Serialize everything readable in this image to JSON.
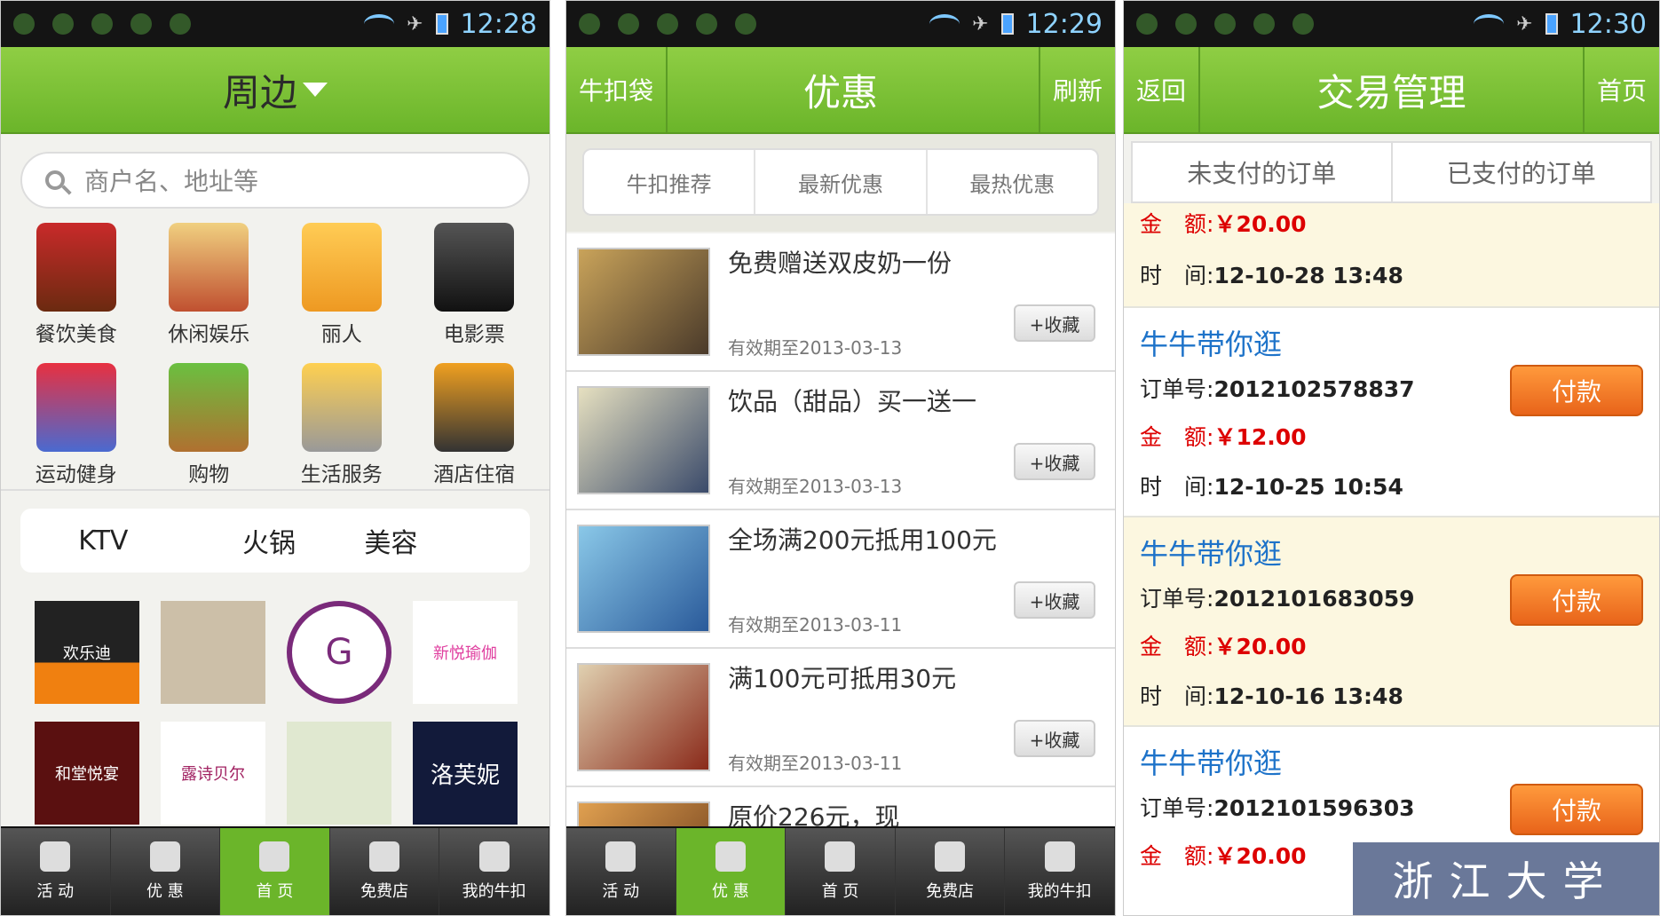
{
  "s1": {
    "time": "12:28",
    "title": "周边",
    "search_placeholder": "商户名、地址等",
    "categories": [
      "餐饮美食",
      "休闲娱乐",
      "丽人",
      "电影票",
      "运动健身",
      "购物",
      "生活服务",
      "酒店住宿"
    ],
    "tags": [
      "KTV",
      "火锅",
      "美容"
    ],
    "logos": [
      "欢乐迪",
      "",
      "G",
      "新悦瑜伽",
      "和堂悦宴",
      "露诗贝尔",
      "",
      "洛芙妮"
    ],
    "nav": [
      "活 动",
      "优 惠",
      "首 页",
      "免费店",
      "我的牛扣"
    ]
  },
  "s2": {
    "time": "12:29",
    "left": "牛扣袋",
    "title": "优惠",
    "right": "刷新",
    "tabs": [
      "牛扣推荐",
      "最新优惠",
      "最热优惠"
    ],
    "deals": [
      {
        "title": "免费赠送双皮奶一份",
        "valid": "有效期至2013-03-13",
        "fav": "+收藏"
      },
      {
        "title": "饮品（甜品）买一送一",
        "valid": "有效期至2013-03-13",
        "fav": "+收藏"
      },
      {
        "title": "全场满200元抵用100元",
        "valid": "有效期至2013-03-11",
        "fav": "+收藏"
      },
      {
        "title": "满100元可抵用30元",
        "valid": "有效期至2013-03-11",
        "fav": "+收藏"
      },
      {
        "title": "原价226元，现",
        "valid": "",
        "fav": ""
      }
    ],
    "nav": [
      "活 动",
      "优 惠",
      "首 页",
      "免费店",
      "我的牛扣"
    ]
  },
  "s3": {
    "time": "12:30",
    "left": "返回",
    "title": "交易管理",
    "right": "首页",
    "tabs": [
      "未支付的订单",
      "已支付的订单"
    ],
    "partial": {
      "amount_label": "金　额:",
      "amount": "￥20.00",
      "time_label": "时　间:",
      "time": "12-10-28 13:48"
    },
    "orders": [
      {
        "name": "牛牛带你逛",
        "no_label": "订单号:",
        "no": "2012102578837",
        "amount_label": "金　额:",
        "amount": "￥12.00",
        "time_label": "时　间:",
        "time": "12-10-25 10:54",
        "pay": "付款"
      },
      {
        "name": "牛牛带你逛",
        "no_label": "订单号:",
        "no": "2012101683059",
        "amount_label": "金　额:",
        "amount": "￥20.00",
        "time_label": "时　间:",
        "time": "12-10-16 13:48",
        "pay": "付款"
      },
      {
        "name": "牛牛带你逛",
        "no_label": "订单号:",
        "no": "2012101596303",
        "amount_label": "金　额:",
        "amount": "￥20.00",
        "time_label": "",
        "time": "",
        "pay": "付款"
      }
    ],
    "watermark": "浙江大学"
  }
}
